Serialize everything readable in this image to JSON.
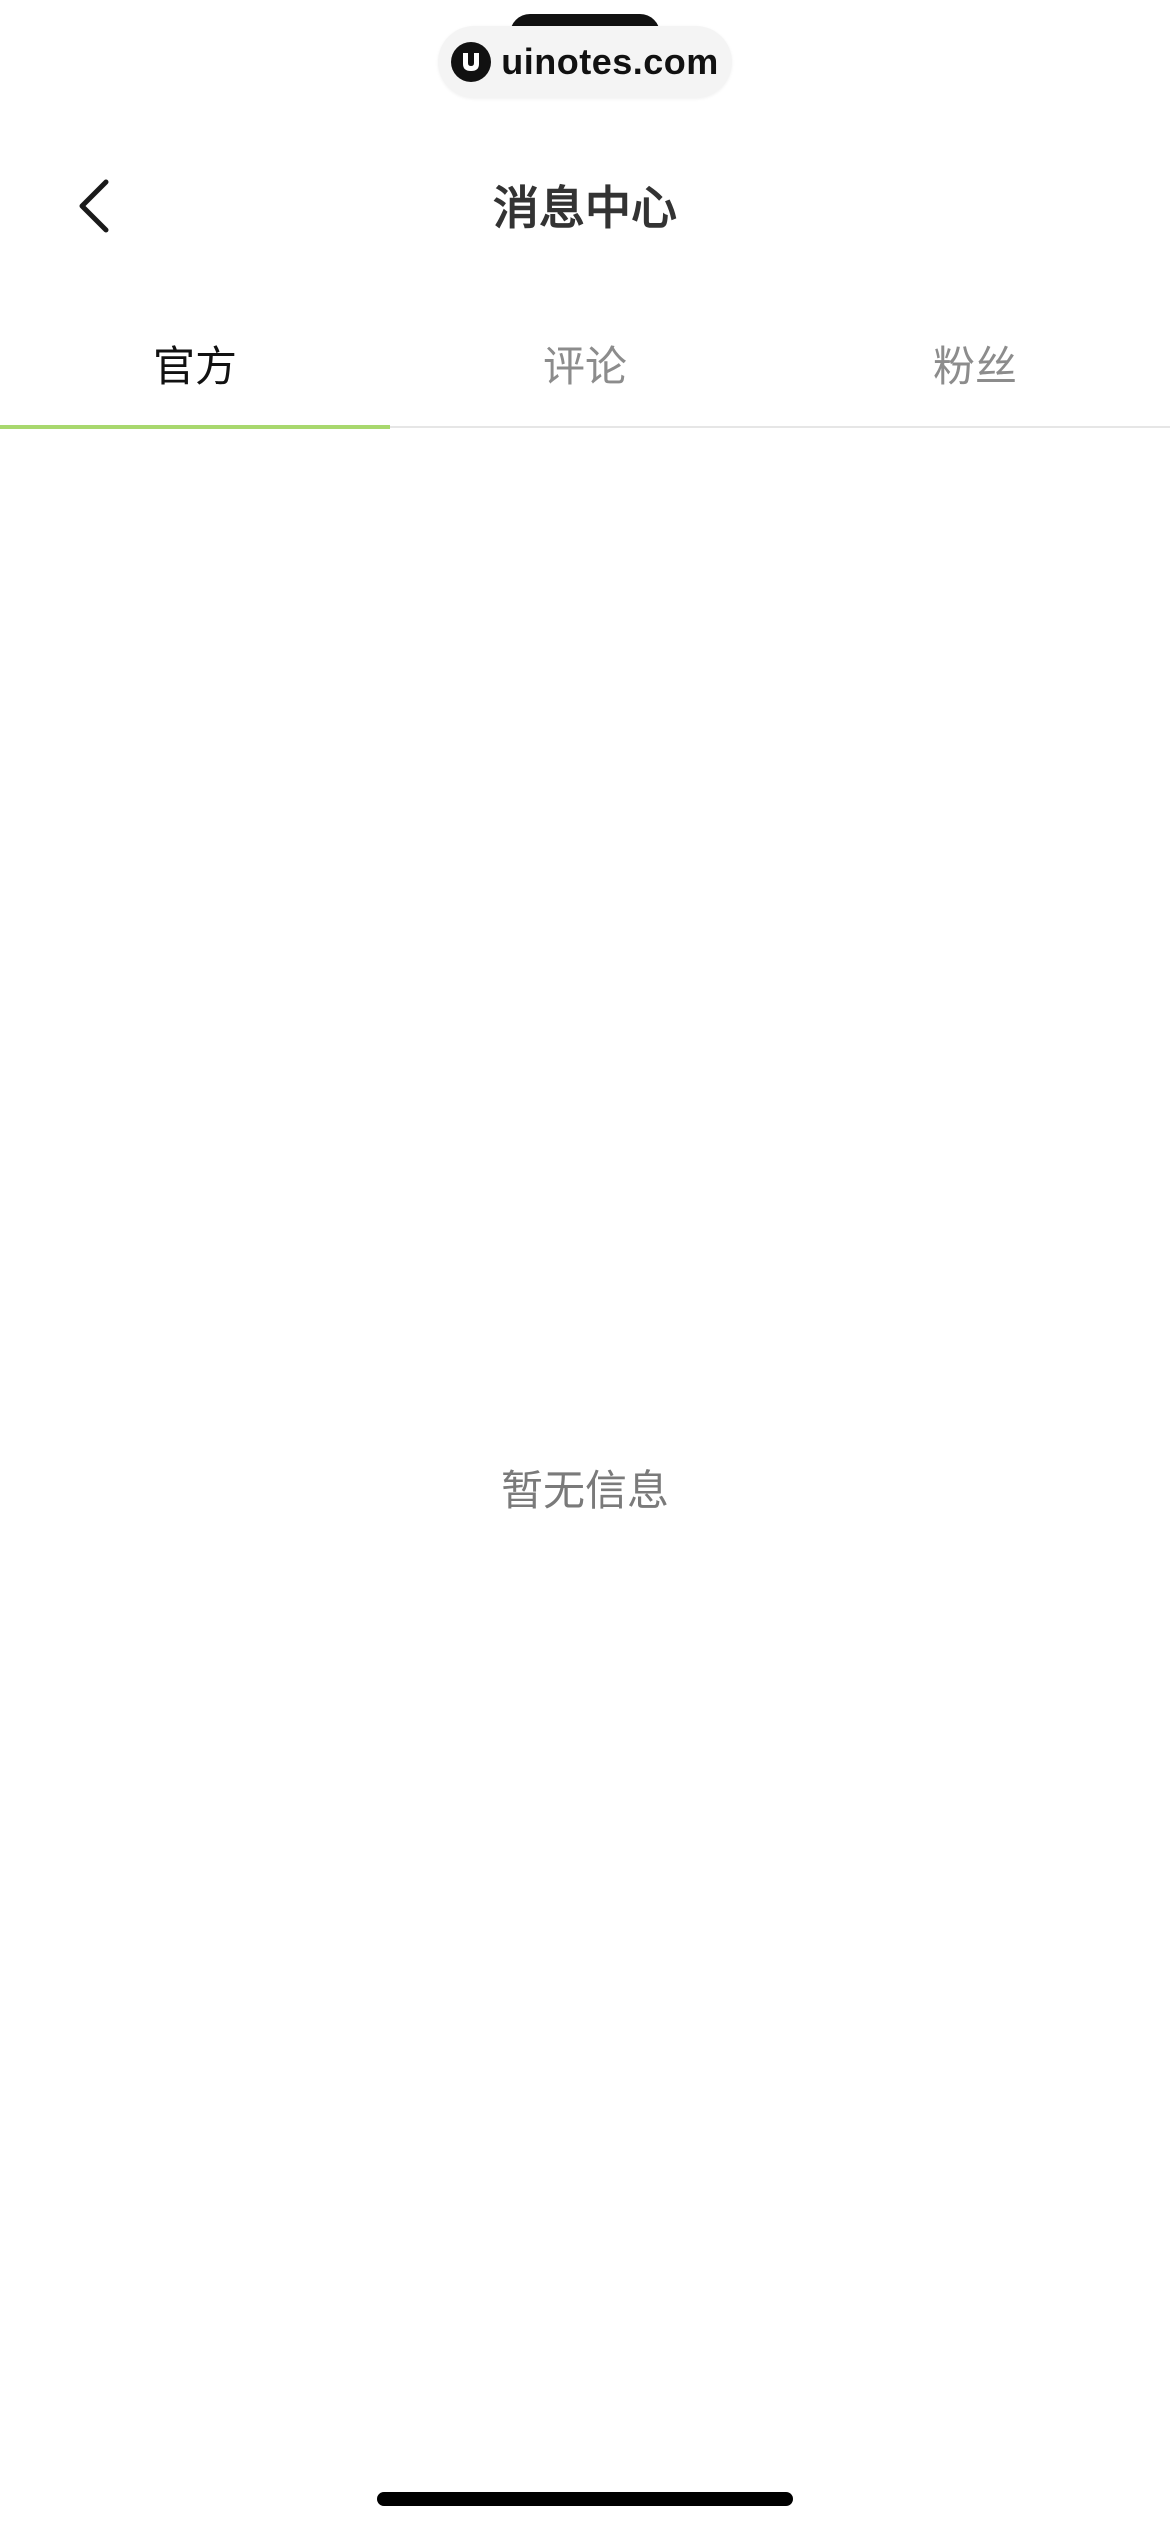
{
  "watermark": {
    "text": "uinotes.com"
  },
  "header": {
    "title": "消息中心",
    "back_icon": "chevron-left-icon"
  },
  "tabs": [
    {
      "label": "官方",
      "active": true
    },
    {
      "label": "评论",
      "active": false
    },
    {
      "label": "粉丝",
      "active": false
    }
  ],
  "empty_state": {
    "message": "暂无信息"
  },
  "colors": {
    "accent": "#a8d86e",
    "active_text": "#111111",
    "inactive_text": "#8c8c8c",
    "title_text": "#333333"
  }
}
